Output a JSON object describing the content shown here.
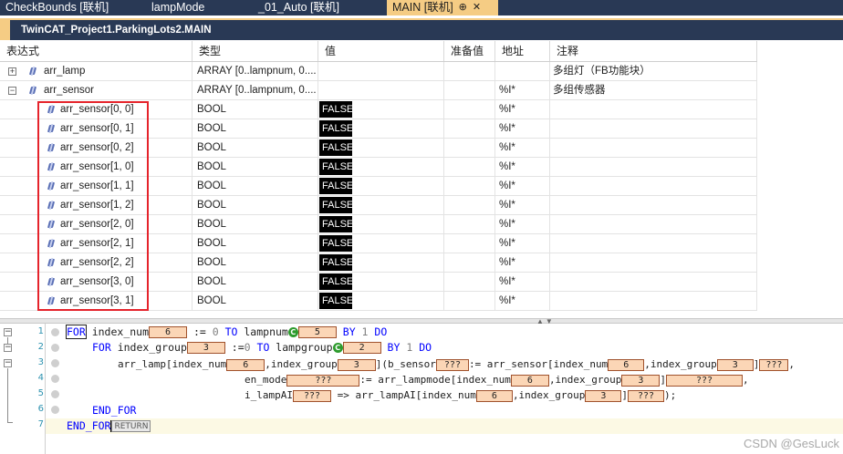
{
  "tabs": [
    {
      "label": "CheckBounds [联机]"
    },
    {
      "label": "lampMode"
    },
    {
      "label": "_01_Auto [联机]"
    },
    {
      "label": "MAIN [联机]"
    }
  ],
  "active_tab": {
    "pin": "⊕",
    "close": "✕"
  },
  "path": "TwinCAT_Project1.ParkingLots2.MAIN",
  "columns": [
    "表达式",
    "类型",
    "值",
    "准备值",
    "地址",
    "注释"
  ],
  "rows": [
    {
      "name": "arr_lamp",
      "type": "ARRAY [0..lampnum, 0....",
      "value": "",
      "address": "",
      "comment": "多组灯（FB功能块）",
      "expander": "+"
    },
    {
      "name": "arr_sensor",
      "type": "ARRAY [0..lampnum, 0....",
      "value": "",
      "address": "%I*",
      "comment": "多组传感器",
      "expander": "−"
    },
    {
      "name": "arr_sensor[0, 0]",
      "type": "BOOL",
      "value": "FALSE",
      "address": "%I*",
      "comment": ""
    },
    {
      "name": "arr_sensor[0, 1]",
      "type": "BOOL",
      "value": "FALSE",
      "address": "%I*",
      "comment": ""
    },
    {
      "name": "arr_sensor[0, 2]",
      "type": "BOOL",
      "value": "FALSE",
      "address": "%I*",
      "comment": ""
    },
    {
      "name": "arr_sensor[1, 0]",
      "type": "BOOL",
      "value": "FALSE",
      "address": "%I*",
      "comment": ""
    },
    {
      "name": "arr_sensor[1, 1]",
      "type": "BOOL",
      "value": "FALSE",
      "address": "%I*",
      "comment": ""
    },
    {
      "name": "arr_sensor[1, 2]",
      "type": "BOOL",
      "value": "FALSE",
      "address": "%I*",
      "comment": ""
    },
    {
      "name": "arr_sensor[2, 0]",
      "type": "BOOL",
      "value": "FALSE",
      "address": "%I*",
      "comment": ""
    },
    {
      "name": "arr_sensor[2, 1]",
      "type": "BOOL",
      "value": "FALSE",
      "address": "%I*",
      "comment": ""
    },
    {
      "name": "arr_sensor[2, 2]",
      "type": "BOOL",
      "value": "FALSE",
      "address": "%I*",
      "comment": ""
    },
    {
      "name": "arr_sensor[3, 0]",
      "type": "BOOL",
      "value": "FALSE",
      "address": "%I*",
      "comment": ""
    },
    {
      "name": "arr_sensor[3, 1]",
      "type": "BOOL",
      "value": "FALSE",
      "address": "%I*",
      "comment": ""
    }
  ],
  "code": {
    "line_numbers": [
      "1",
      "2",
      "3",
      "4",
      "5",
      "6",
      "7"
    ],
    "l1": {
      "for": "FOR",
      "a": " index_num",
      "v1": "6",
      "b": " := ",
      "n0": "0",
      "to": " TO",
      "c": " lampnum",
      "c_icon": "C",
      "v2": "5",
      "by": " BY",
      "n1": " 1",
      "do": " DO"
    },
    "l2": {
      "for": "FOR",
      "a": " index_group",
      "v1": "3",
      "b": " :=",
      "n0": "0",
      "to": " TO",
      "c": " lampgroup",
      "c_icon": "C",
      "v2": "2",
      "by": " BY",
      "n1": " 1",
      "do": " DO"
    },
    "l3": {
      "a": "arr_lamp[index_num",
      "v1": "6",
      "b": ",index_group",
      "v2": "3",
      "c": "](b_sensor",
      "v3": "???",
      "d": ":= arr_sensor[index_num",
      "v4": "6",
      "e": ",index_group",
      "v5": "3",
      "f": "]",
      "v6": "???",
      "g": ","
    },
    "l4": {
      "a": "en_mode",
      "v1": "???",
      "b": ":= arr_lampmode[index_num",
      "v2": "6",
      "c": ",index_group",
      "v3": "3",
      "d": "]",
      "v4": "???",
      "e": ","
    },
    "l5": {
      "a": "i_lampAI",
      "v1": "???",
      "b": " => arr_lampAI[index_num",
      "v2": "6",
      "c": ",index_group",
      "v3": "3",
      "d": "]",
      "v4": "???",
      "e": ");"
    },
    "l6": {
      "end": "END_FOR"
    },
    "l7": {
      "end": "END_FOR",
      "ret": "RETURN"
    }
  },
  "watermark": "CSDN @GesLuck"
}
